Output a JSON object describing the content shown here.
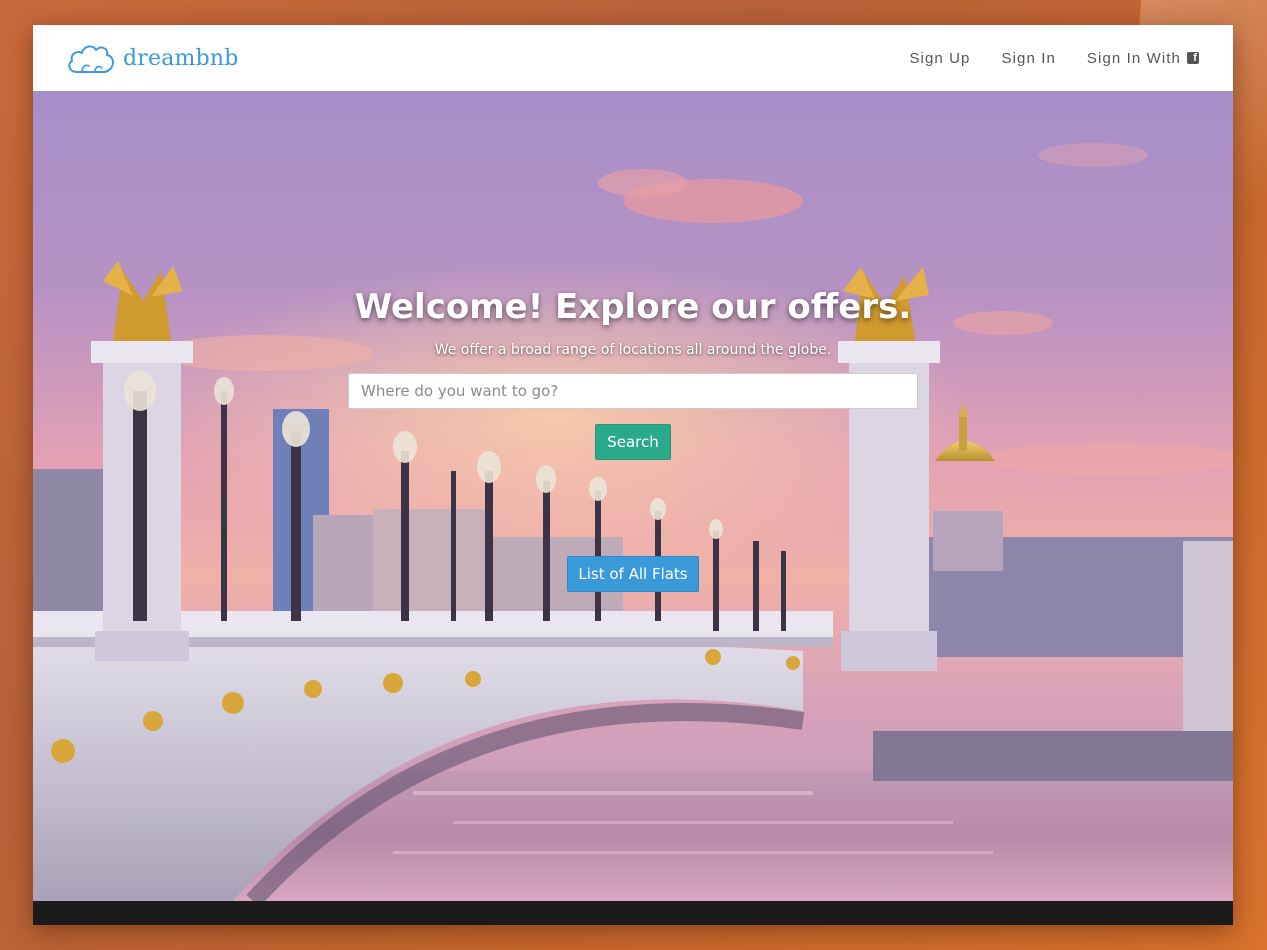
{
  "brand": {
    "name": "dreambnb",
    "icon": "cloud-logo-icon",
    "color": "#3a9ad9"
  },
  "nav": {
    "items": [
      {
        "label": "Sign Up"
      },
      {
        "label": "Sign In"
      },
      {
        "label": "Sign In With",
        "icon": "facebook-icon"
      }
    ]
  },
  "hero": {
    "title": "Welcome! Explore our offers.",
    "subtitle": "We offer a broad range of locations all around the globe.",
    "search": {
      "placeholder": "Where do you want to go?",
      "value": ""
    },
    "search_button": "Search",
    "list_button": "List of All Flats",
    "image": "paris-bridge-sunset-photo"
  },
  "colors": {
    "search_button": "#2aaa8a",
    "list_button": "#3a9ad9",
    "brand": "#3a9ad9",
    "background": "#c4662f"
  }
}
